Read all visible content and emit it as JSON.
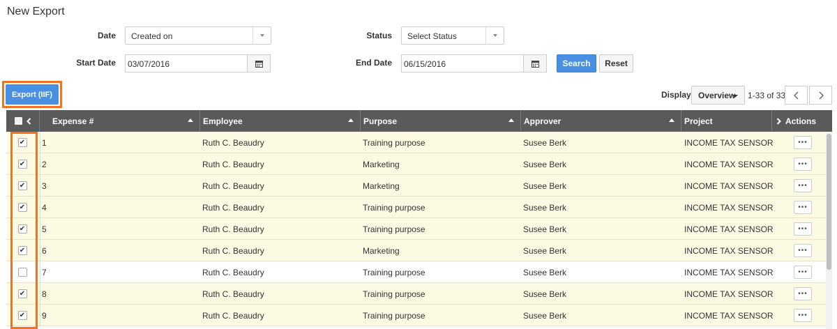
{
  "page": {
    "title": "New Export"
  },
  "filters": {
    "date_label": "Date",
    "date_value": "Created on",
    "status_label": "Status",
    "status_value": "Select Status",
    "start_label": "Start Date",
    "start_value": "03/07/2016",
    "end_label": "End Date",
    "end_value": "06/15/2016",
    "search_label": "Search",
    "reset_label": "Reset"
  },
  "toolbar": {
    "export_label": "Export (IIF)",
    "display_label": "Display",
    "display_value": "Overview",
    "range_text": "1-33 of 33"
  },
  "table": {
    "columns": {
      "expense": "Expense #",
      "employee": "Employee",
      "purpose": "Purpose",
      "approver": "Approver",
      "project": "Project",
      "actions": "Actions"
    },
    "rows": [
      {
        "checked": true,
        "expense": "1",
        "employee": "Ruth C. Beaudry",
        "purpose": "Training purpose",
        "approver": "Susee Berk",
        "project": "INCOME TAX SENSOR"
      },
      {
        "checked": true,
        "expense": "2",
        "employee": "Ruth C. Beaudry",
        "purpose": "Marketing",
        "approver": "Susee Berk",
        "project": "INCOME TAX SENSOR"
      },
      {
        "checked": true,
        "expense": "3",
        "employee": "Ruth C. Beaudry",
        "purpose": "Marketing",
        "approver": "Susee Berk",
        "project": "INCOME TAX SENSOR"
      },
      {
        "checked": true,
        "expense": "4",
        "employee": "Ruth C. Beaudry",
        "purpose": "Training purpose",
        "approver": "Susee Berk",
        "project": "INCOME TAX SENSOR"
      },
      {
        "checked": true,
        "expense": "5",
        "employee": "Ruth C. Beaudry",
        "purpose": "Training purpose",
        "approver": "Susee Berk",
        "project": "INCOME TAX SENSOR"
      },
      {
        "checked": true,
        "expense": "6",
        "employee": "Ruth C. Beaudry",
        "purpose": "Marketing",
        "approver": "Susee Berk",
        "project": "INCOME TAX SENSOR"
      },
      {
        "checked": false,
        "expense": "7",
        "employee": "Ruth C. Beaudry",
        "purpose": "Training purpose",
        "approver": "Susee Berk",
        "project": "INCOME TAX SENSOR"
      },
      {
        "checked": true,
        "expense": "8",
        "employee": "Ruth C. Beaudry",
        "purpose": "Training purpose",
        "approver": "Susee Berk",
        "project": "INCOME TAX SENSOR"
      },
      {
        "checked": true,
        "expense": "9",
        "employee": "Ruth C. Beaudry",
        "purpose": "Training purpose",
        "approver": "Susee Berk",
        "project": "INCOME TAX SENSOR"
      }
    ]
  },
  "colors": {
    "accent": "#4a90e2",
    "highlight": "#f07321",
    "header_bg": "#5a5a5a",
    "selected_row_bg": "#fcfae3"
  },
  "icons": {
    "calendar": "calendar-icon",
    "collapse": "chevron-left-icon",
    "expand": "chevron-right-icon",
    "prev": "chevron-left-icon",
    "next": "chevron-right-icon",
    "sort": "sort-up-icon",
    "more": "more-dots-icon"
  }
}
